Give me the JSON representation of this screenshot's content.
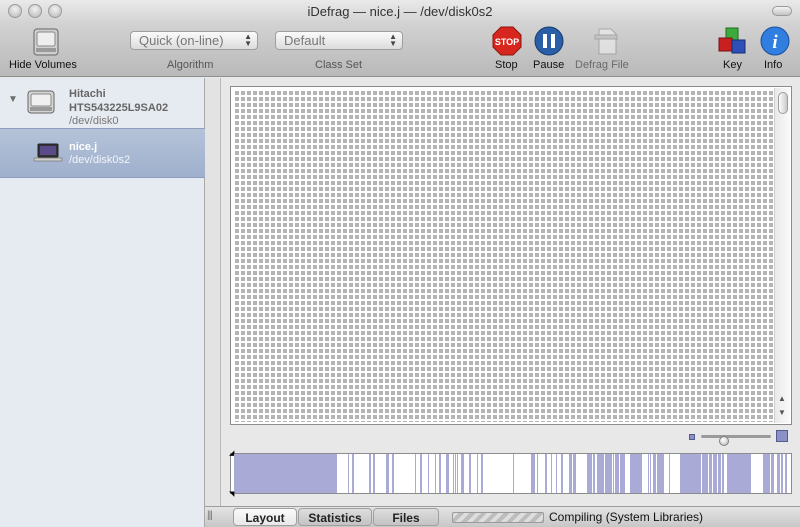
{
  "window": {
    "title": "iDefrag — nice.j — /dev/disk0s2"
  },
  "toolbar": {
    "hide_volumes_label": "Hide Volumes",
    "algorithm": {
      "value": "Quick (on-line)",
      "label": "Algorithm"
    },
    "class_set": {
      "value": "Default",
      "label": "Class Set"
    },
    "stop_label": "Stop",
    "stop_badge": "STOP",
    "pause_label": "Pause",
    "defrag_file_label": "Defrag File",
    "key_label": "Key",
    "info_label": "Info",
    "info_glyph": "i"
  },
  "sidebar": {
    "disk": {
      "name": "Hitachi",
      "model": "HTS543225L9SA02",
      "device": "/dev/disk0"
    },
    "volume": {
      "name": "nice.j",
      "device": "/dev/disk0s2",
      "selected": true
    }
  },
  "map": {
    "zoom_level": 0.3,
    "scroll_position": 0
  },
  "tabs": [
    {
      "label": "Layout",
      "active": true
    },
    {
      "label": "Statistics",
      "active": false
    },
    {
      "label": "Files",
      "active": false
    }
  ],
  "status": {
    "text": "Compiling (System Libraries)"
  },
  "colors": {
    "used_block": "#a9aad5",
    "free_block": "#ffffff",
    "map_block": "#b4b4b4",
    "selection": "#a9b8d2"
  }
}
